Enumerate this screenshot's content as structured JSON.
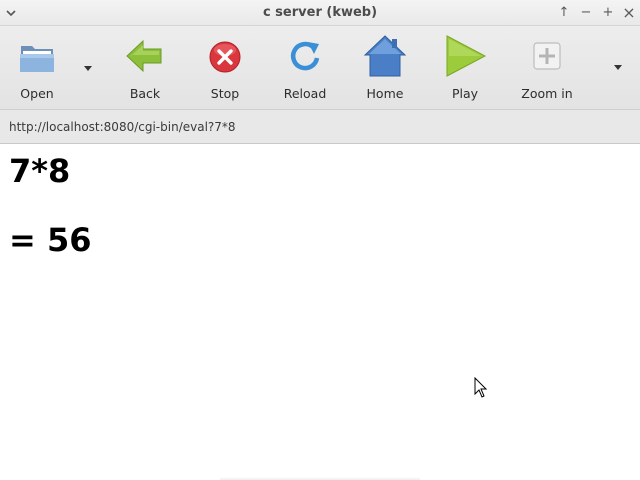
{
  "window": {
    "title": "c server (kweb)",
    "controls": {
      "up": "↑",
      "minimize": "−",
      "maximize": "+",
      "close": "×"
    }
  },
  "toolbar": {
    "buttons": [
      {
        "label": "Open",
        "icon": "folder-icon"
      },
      {
        "label": "Back",
        "icon": "back-arrow-icon"
      },
      {
        "label": "Stop",
        "icon": "stop-icon"
      },
      {
        "label": "Reload",
        "icon": "reload-icon"
      },
      {
        "label": "Home",
        "icon": "home-icon"
      },
      {
        "label": "Play",
        "icon": "play-icon"
      },
      {
        "label": "Zoom in",
        "icon": "zoom-in-icon"
      }
    ]
  },
  "address": {
    "url": "http://localhost:8080/cgi-bin/eval?7*8"
  },
  "page": {
    "expression": "7*8",
    "result": "= 56"
  },
  "colors": {
    "back_arrow": "#8cbf3a",
    "stop": "#d9363e",
    "reload": "#3b8fd6",
    "home": "#4a7fc8",
    "play": "#9ccc3c",
    "folder": "#7fa9d8"
  }
}
